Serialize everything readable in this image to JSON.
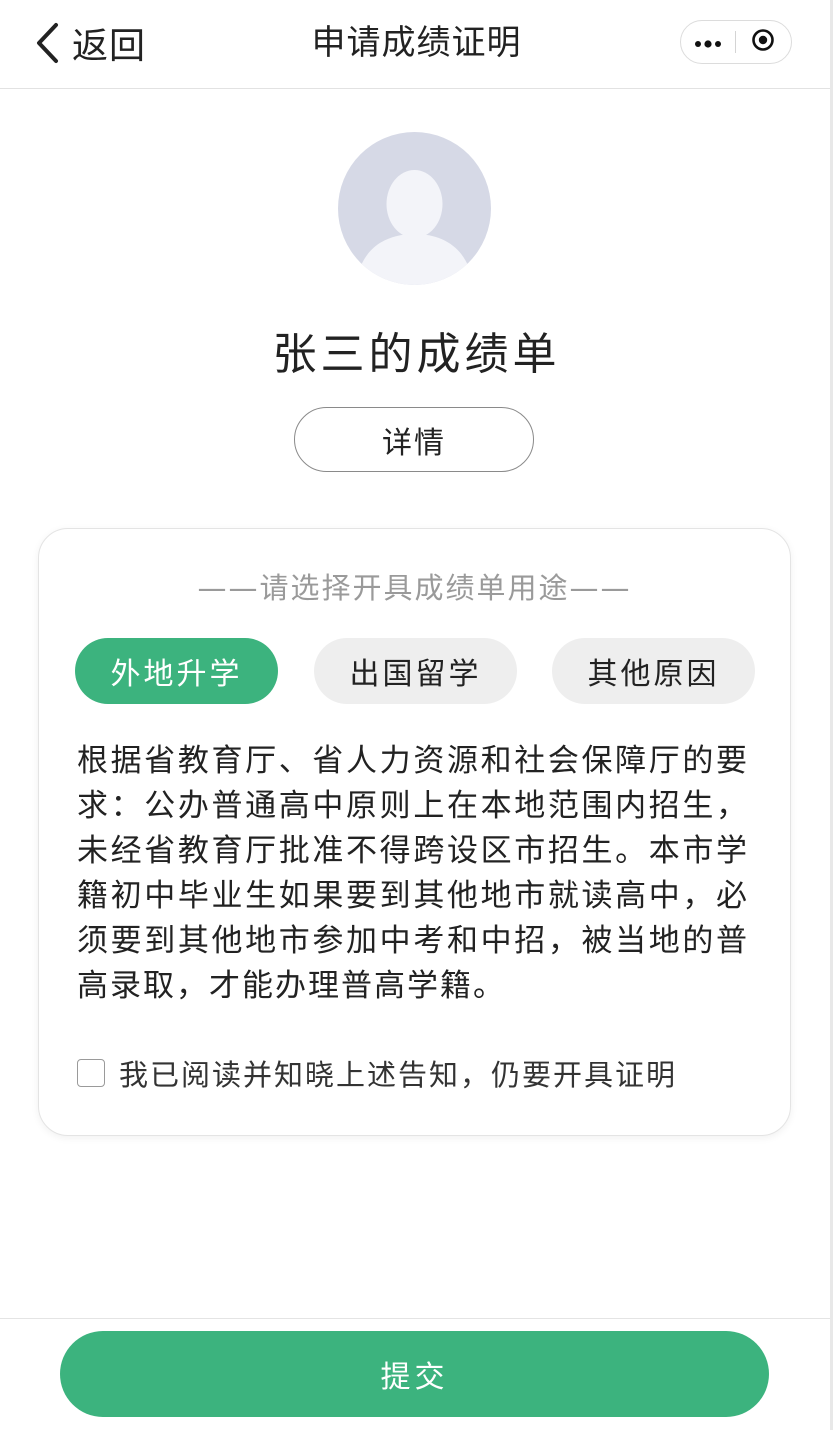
{
  "navbar": {
    "back_label": "返回",
    "title": "申请成绩证明",
    "back_icon": "chevron-left-icon",
    "more_icon": "more-dots-icon",
    "close_icon": "target-close-icon"
  },
  "profile": {
    "avatar_icon": "default-avatar-icon",
    "title": "张三的成绩单",
    "detail_label": "详情"
  },
  "purpose": {
    "title": "——请选择开具成绩单用途——",
    "options": [
      {
        "label": "外地升学",
        "selected": true
      },
      {
        "label": "出国留学",
        "selected": false
      },
      {
        "label": "其他原因",
        "selected": false
      }
    ],
    "notice": "根据省教育厅、省人力资源和社会保障厅的要求：公办普通高中原则上在本地范围内招生，未经省教育厅批准不得跨设区市招生。本市学籍初中毕业生如果要到其他地市就读高中，必须要到其他地市参加中考和中招，被当地的普高录取，才能办理普高学籍。",
    "agree_label": "我已阅读并知晓上述告知，仍要开具证明",
    "agree_checked": false
  },
  "footer": {
    "submit_label": "提交"
  },
  "colors": {
    "accent": "#3cb37e",
    "option_inactive": "#eeeeee",
    "avatar_bg": "#d6d9e6",
    "muted_text": "#9a9a9a"
  }
}
